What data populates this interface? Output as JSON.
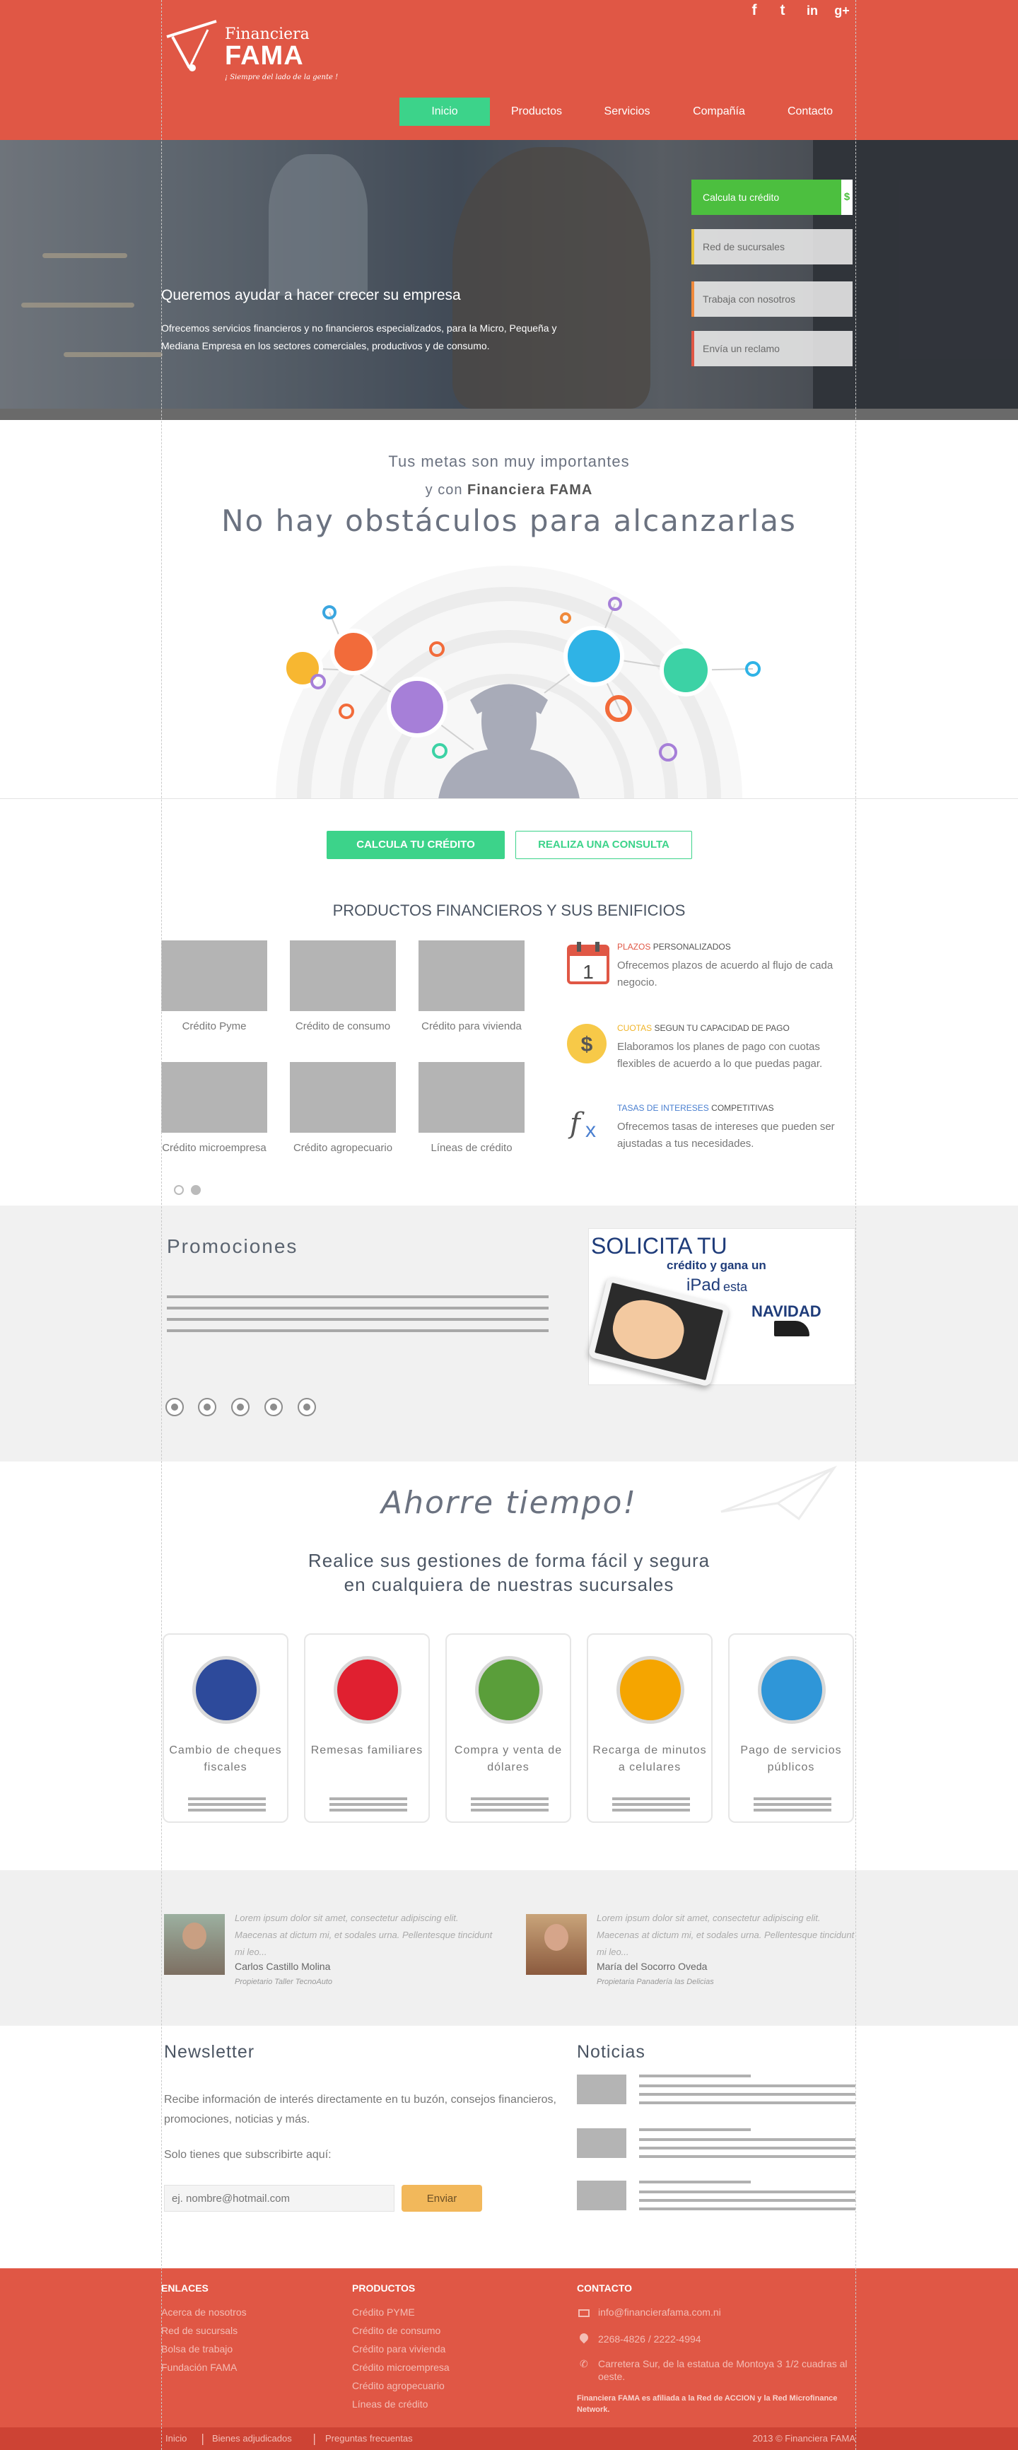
{
  "brand": {
    "name": "Financiera",
    "brand": "FAMA",
    "tagline": "¡ Siempre del lado de la gente !"
  },
  "social": [
    "f",
    "t",
    "in",
    "g+"
  ],
  "nav": {
    "items": [
      "Inicio",
      "Productos",
      "Servicios",
      "Compañía",
      "Contacto"
    ],
    "active": "Inicio"
  },
  "hero": {
    "title": "Queremos ayudar a hacer crecer su empresa",
    "text": "Ofrecemos servicios financieros y no financieros especializados, para la Micro, Pequeña y Mediana Empresa en los sectores comerciales, productivos y de consumo.",
    "buttons": [
      "Calcula tu crédito",
      "Red de sucursales",
      "Trabaja con nosotros",
      "Envía un reclamo"
    ],
    "button_icon": "$"
  },
  "goals": {
    "line1": "Tus metas son muy importantes",
    "line2_prefix": "y con",
    "line2_brand": "Financiera FAMA",
    "line3": "No hay obstáculos para alcanzarlas"
  },
  "cta": {
    "primary": "CALCULA TU CRÉDITO",
    "secondary": "REALIZA UNA CONSULTA"
  },
  "products": {
    "title": "PRODUCTOS FINANCIEROS Y SUS BENIFICIOS",
    "items": [
      "Crédito Pyme",
      "Crédito de consumo",
      "Crédito para vivienda",
      "Crédito microempresa",
      "Crédito agropecuario",
      "Líneas de crédito"
    ]
  },
  "benefits": [
    {
      "highlight": "PLAZOS",
      "rest": "PERSONALIZADOS",
      "text": "Ofrecemos plazos de acuerdo al flujo de cada negocio.",
      "icon": "calendar-icon",
      "color": "#e05745"
    },
    {
      "highlight": "CUOTAS",
      "rest": "SEGUN TU CAPACIDAD DE PAGO",
      "text": "Elaboramos los planes de pago con cuotas flexibles de acuerdo a lo que puedas pagar.",
      "icon": "dollar-coin-icon",
      "color": "#f0b429"
    },
    {
      "highlight": "TASAS DE INTERESES",
      "rest": "COMPETITIVAS",
      "text": "Ofrecemos tasas de intereses que pueden ser ajustadas a tus necesidades.",
      "icon": "function-icon",
      "color": "#4a7fd0"
    }
  ],
  "calendar_day": "1",
  "promotions": {
    "title": "Promociones",
    "ad_line1": "SOLICITA TU",
    "ad_line2": "crédito y gana un",
    "ad_line3": "iPad",
    "ad_line3b": "esta",
    "ad_line4": "NAVIDAD"
  },
  "services": {
    "title": "Ahorre tiempo!",
    "subtitle_line1": "Realice sus gestiones de forma fácil y segura",
    "subtitle_line2": "en cualquiera de nuestras sucursales",
    "items": [
      {
        "label": "Cambio de cheques fiscales",
        "icon": "check-icon",
        "color": "#2d4a9b"
      },
      {
        "label": "Remesas familiares",
        "icon": "family-icon",
        "color": "#e02030"
      },
      {
        "label": "Compra y venta de dólares",
        "icon": "dollar-bill-icon",
        "color": "#5a9e3a"
      },
      {
        "label": "Recarga de minutos a celulares",
        "icon": "phone-icon",
        "color": "#f5a500"
      },
      {
        "label": "Pago de servicios públicos",
        "icon": "faucet-icon",
        "color": "#2f96d8"
      }
    ]
  },
  "testimonials": [
    {
      "quote": "Lorem ipsum dolor sit amet, consectetur adipiscing elit. Maecenas at dictum mi, et sodales urna. Pellentesque tincidunt mi leo...",
      "name": "Carlos Castillo Molina",
      "role": "Propietario Taller TecnoAuto"
    },
    {
      "quote": "Lorem ipsum dolor sit amet, consectetur adipiscing elit. Maecenas at dictum mi, et sodales urna. Pellentesque tincidunt mi leo...",
      "name": "María del Socorro Oveda",
      "role": "Propietaria Panadería las Delicias"
    }
  ],
  "newsletter": {
    "title": "Newsletter",
    "text": "Recibe información de interés directamente en tu buzón, consejos financieros, promociones, noticias y más.",
    "text2": "Solo tienes que subscribirte aquí:",
    "placeholder": "ej. nombre@hotmail.com",
    "button": "Enviar"
  },
  "news": {
    "title": "Noticias"
  },
  "footer": {
    "enlaces_title": "ENLACES",
    "enlaces": [
      "Acerca de nosotros",
      "Red de sucursals",
      "Bolsa de trabajo",
      "Fundación FAMA"
    ],
    "productos_title": "PRODUCTOS",
    "productos": [
      "Crédito PYME",
      "Crédito de consumo",
      "Crédito para vivienda",
      "Crédito microempresa",
      "Crédito agropecuario",
      "Líneas de crédito"
    ],
    "contacto_title": "CONTACTO",
    "email": "info@financierafama.com.ni",
    "phone": "2268-4826 / 2222-4994",
    "address": "Carretera Sur, de la estatua de Montoya 3 1/2 cuadras al oeste.",
    "note": "Financiera FAMA es afiliada a la Red de ACCION y la Red Microfinance Network.",
    "bottom_links": [
      "Inicio",
      "Bienes adjudicados",
      "Preguntas frecuentas"
    ],
    "copyright": "2013 © Financiera FAMA"
  }
}
